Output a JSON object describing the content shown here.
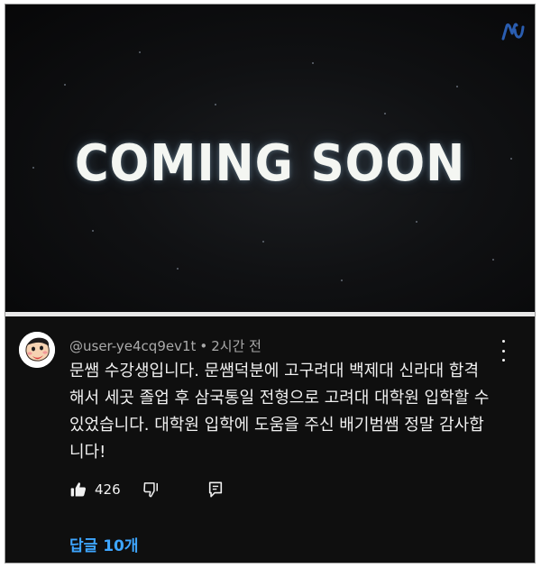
{
  "video": {
    "title": "COMING SOON",
    "channel_logo_icon": "nu-logo-icon"
  },
  "comment": {
    "author": "@user-ye4cq9ev1t",
    "separator": "•",
    "time": "2시간 전",
    "lines": [
      "문쌤 수강생입니다. 문쌤덕분에 고구려대 백제대 신라대 합격",
      "해서 세곳 졸업 후 삼국통일 전형으로 고려대 대학원 입학할 수",
      "있었습니다. 대학원 입학에 도움을 주신 배기범쌤 정말 감사합",
      "니다!"
    ],
    "like_count": "426",
    "replies_label": "답글 10개",
    "icons": {
      "like": "thumbs-up-icon",
      "dislike": "thumbs-down-icon",
      "reply": "reply-comment-icon",
      "more": "more-vertical-icon"
    }
  },
  "colors": {
    "background": "#0f0f0f",
    "text": "#f1f1f1",
    "meta": "#aaaaaa",
    "link": "#3ea6ff",
    "logo": "#2a5db0"
  }
}
